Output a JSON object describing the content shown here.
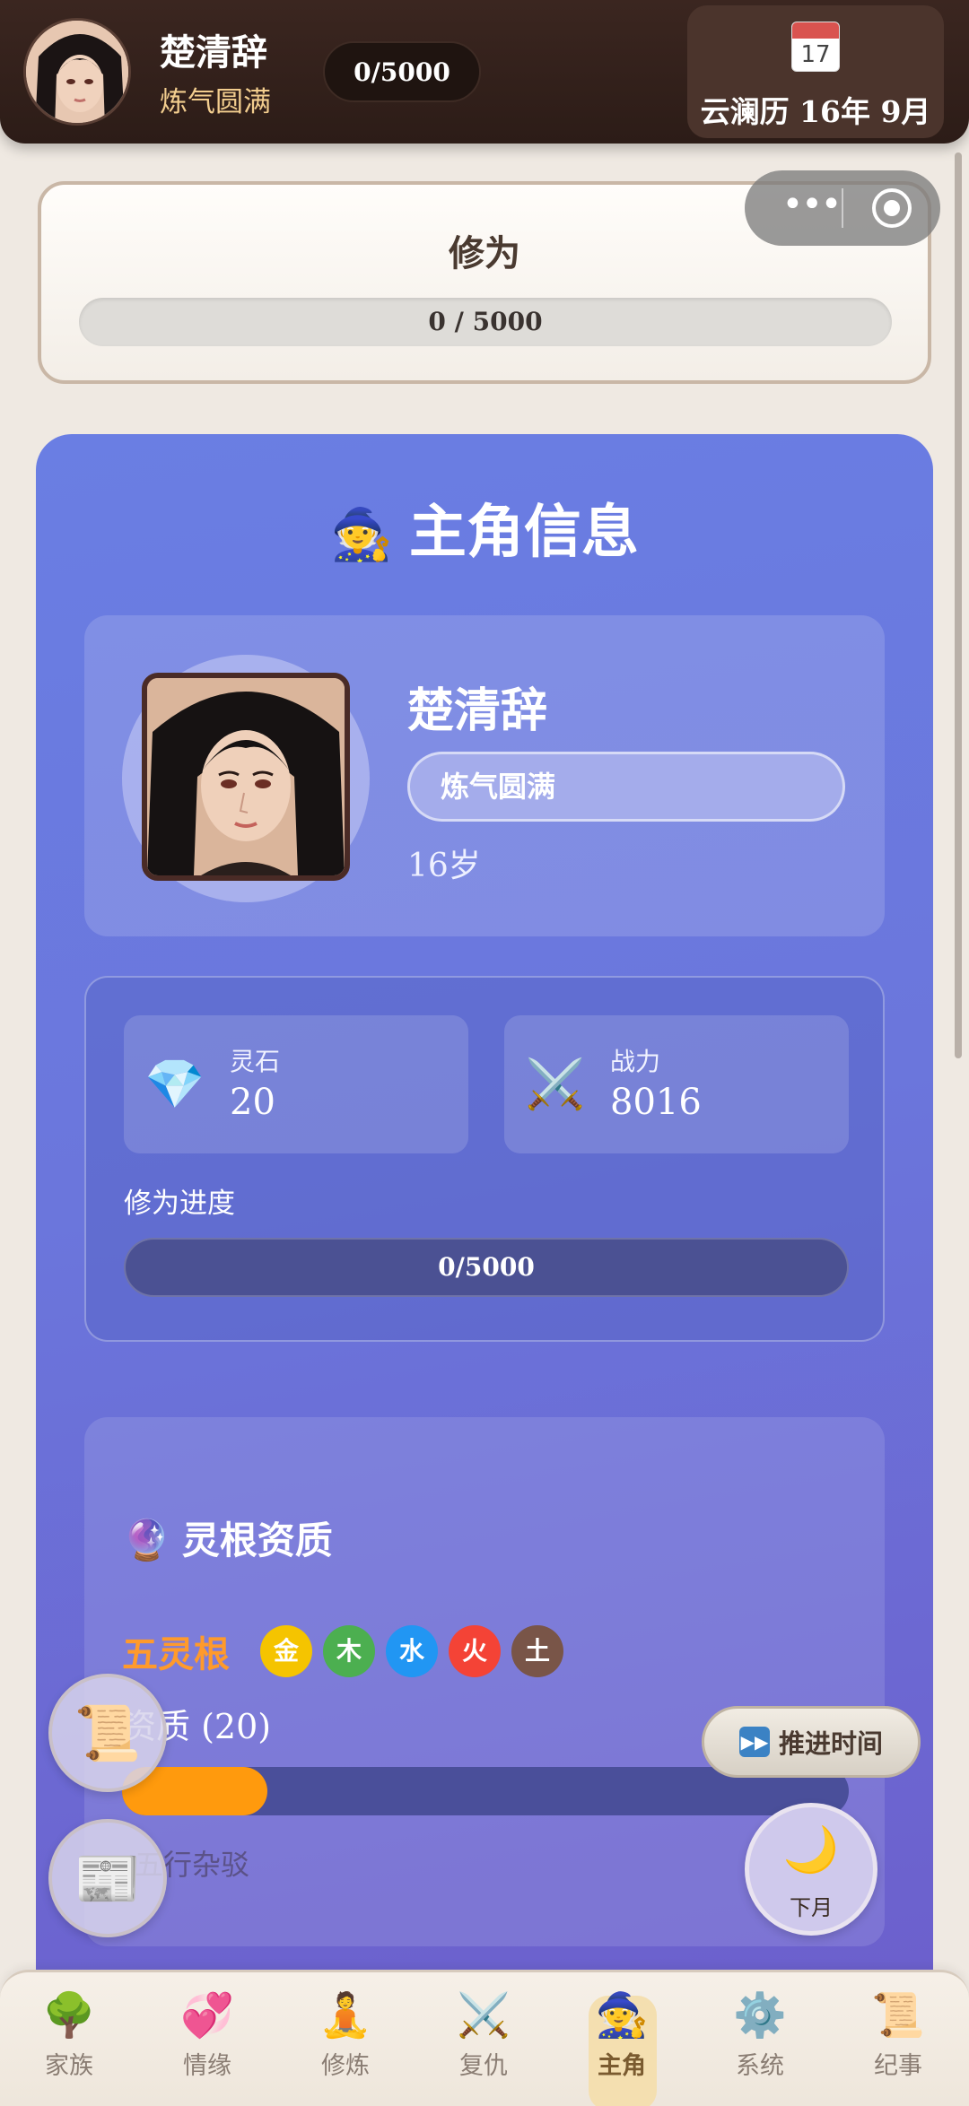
{
  "header": {
    "name": "楚清辞",
    "realm": "炼气圆满",
    "cultivation": "0/5000",
    "calendar_icon_day": "17",
    "date": "云澜历 16年 9月"
  },
  "cultivation_card": {
    "title": "修为",
    "progress_text": "0 / 5000",
    "progress_fraction": 0
  },
  "main": {
    "title": "主角信息",
    "title_emoji": "🧙",
    "profile": {
      "name": "楚清辞",
      "realm": "炼气圆满",
      "age": "16岁"
    },
    "stats": {
      "spirit_stone_label": "灵石",
      "spirit_stone_value": "20",
      "spirit_stone_icon": "💎",
      "power_label": "战力",
      "power_value": "8016",
      "power_icon": "⚔️",
      "progress_label": "修为进度",
      "progress_text": "0/5000",
      "progress_fraction": 0
    },
    "spirit_root": {
      "title": "灵根资质",
      "title_emoji": "🔮",
      "type": "五灵根",
      "elements": [
        {
          "label": "金",
          "color": "#f5c400"
        },
        {
          "label": "木",
          "color": "#4caf50"
        },
        {
          "label": "水",
          "color": "#2196f3"
        },
        {
          "label": "火",
          "color": "#f44336"
        },
        {
          "label": "土",
          "color": "#795548"
        }
      ],
      "aptitude_label": "资质 (20)",
      "aptitude_fraction": 0.2,
      "note": "五行杂驳"
    }
  },
  "floating": {
    "scroll_icon": "📜",
    "news_icon": "📰",
    "advance_label": "推进时间",
    "advance_icon": "⏩",
    "next_month_icon": "🌙",
    "next_month_label": "下月"
  },
  "nav": [
    {
      "label": "家族",
      "icon": "🌳"
    },
    {
      "label": "情缘",
      "icon": "💞"
    },
    {
      "label": "修炼",
      "icon": "🧘"
    },
    {
      "label": "复仇",
      "icon": "⚔️"
    },
    {
      "label": "主角",
      "icon": "🧙",
      "active": true
    },
    {
      "label": "系统",
      "icon": "⚙️"
    },
    {
      "label": "纪事",
      "icon": "📜"
    }
  ]
}
